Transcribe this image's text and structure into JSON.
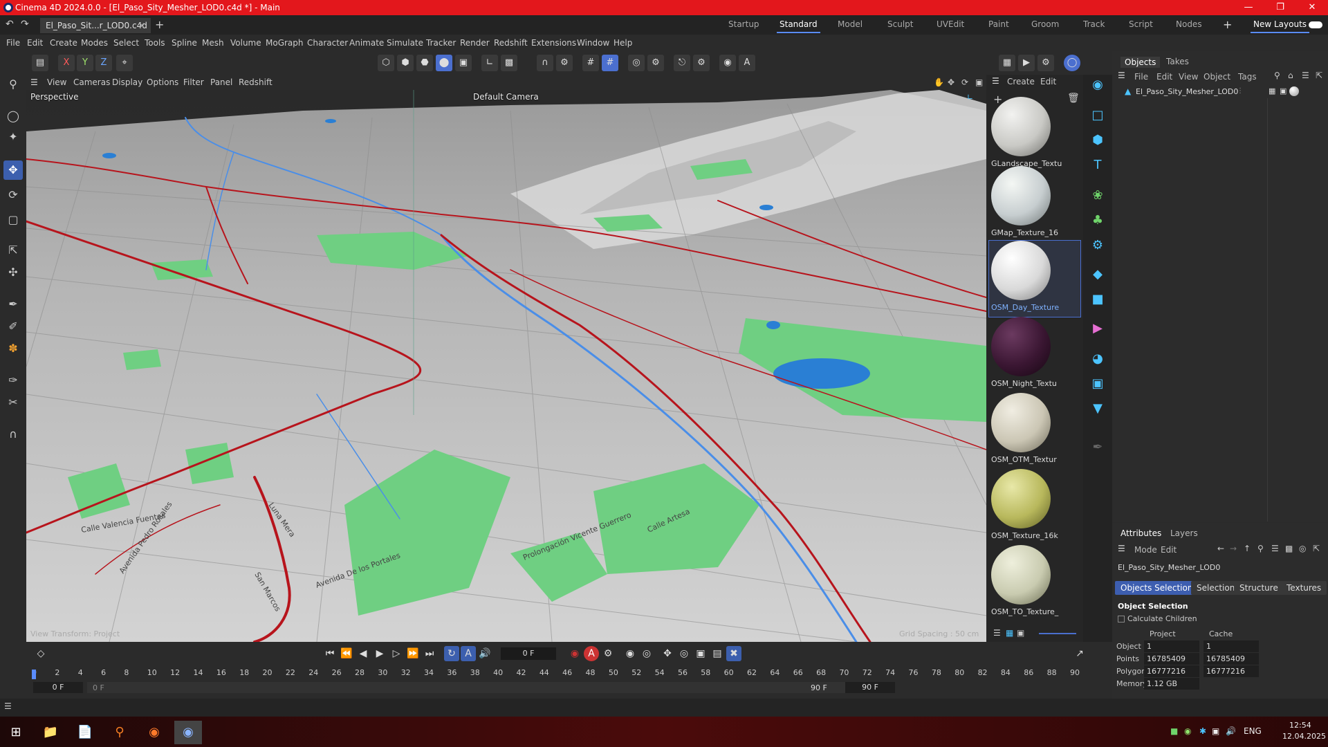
{
  "window": {
    "title": "Cinema 4D 2024.0.0 - [El_Paso_Sity_Mesher_LOD0.c4d *] - Main"
  },
  "document_tab": {
    "label": "El_Paso_Sit...r_LOD0.c4d *"
  },
  "layouts": [
    "Startup",
    "Standard",
    "Model",
    "Sculpt",
    "UVEdit",
    "Paint",
    "Groom",
    "Track",
    "Script",
    "Nodes"
  ],
  "new_layouts": "New Layouts",
  "menus": [
    "File",
    "Edit",
    "Create",
    "Modes",
    "Select",
    "Tools",
    "Spline",
    "Mesh",
    "Volume",
    "MoGraph",
    "Character",
    "Animate",
    "Simulate",
    "Tracker",
    "Render",
    "Redshift",
    "Extensions",
    "Window",
    "Help"
  ],
  "axes": {
    "x": "X",
    "y": "Y",
    "z": "Z"
  },
  "viewport_menu": [
    "View",
    "Cameras",
    "Display",
    "Options",
    "Filter",
    "Panel",
    "Redshift"
  ],
  "viewport": {
    "name": "Perspective",
    "camera": "Default Camera",
    "bottom_left": "View Transform: Project",
    "bottom_right": "Grid Spacing : 50 cm",
    "street_labels": [
      "Calle Valencia Fuentes",
      "Avenida Pedro Rosales",
      "Avenida De los Portales",
      "Prolongación Vicente Guerrero",
      "Calle Artesa",
      "Luna Mera",
      "San Marcos"
    ]
  },
  "material_menu": [
    "Create",
    "Edit"
  ],
  "materials": [
    {
      "name": "GLandscape_Textu",
      "color": "#c9c9c5"
    },
    {
      "name": "GMap_Texture_16",
      "color": "#c7ced0"
    },
    {
      "name": "OSM_Day_Texture",
      "color": "#d9d9d9"
    },
    {
      "name": "OSM_Night_Textu",
      "color": "#3a1632"
    },
    {
      "name": "OSM_OTM_Textur",
      "color": "#cbc6b4"
    },
    {
      "name": "OSM_Texture_16k",
      "color": "#b8b85c"
    },
    {
      "name": "OSM_TO_Texture_",
      "color": "#c9cbb0"
    }
  ],
  "objects_panel": {
    "tabs": [
      "Objects",
      "Takes"
    ],
    "menu": [
      "File",
      "Edit",
      "View",
      "Object",
      "Tags"
    ],
    "items": [
      {
        "name": "El_Paso_Sity_Mesher_LOD0"
      }
    ]
  },
  "attributes": {
    "tabs": [
      "Attributes",
      "Layers"
    ],
    "menu": [
      "Mode",
      "Edit"
    ],
    "object_name": "El_Paso_Sity_Mesher_LOD0",
    "buttons": [
      "Objects Selection",
      "Selection",
      "Structure",
      "Textures"
    ],
    "section": "Object Selection",
    "checkbox_label": "Calculate Children",
    "col_project": "Project",
    "col_cache": "Cache",
    "rows": [
      {
        "label": "Object",
        "project": "1",
        "cache": "1"
      },
      {
        "label": "Points",
        "project": "16785409",
        "cache": "16785409"
      },
      {
        "label": "Polygons",
        "project": "16777216",
        "cache": "16777216"
      },
      {
        "label": "Memory",
        "project": "1.12 GB",
        "cache": ""
      }
    ]
  },
  "timeline": {
    "current_frame": "0 F",
    "ticks": [
      "0",
      "2",
      "4",
      "6",
      "8",
      "10",
      "12",
      "14",
      "16",
      "18",
      "20",
      "22",
      "24",
      "26",
      "28",
      "30",
      "32",
      "34",
      "36",
      "38",
      "40",
      "42",
      "44",
      "46",
      "48",
      "50",
      "52",
      "54",
      "56",
      "58",
      "60",
      "62",
      "64",
      "66",
      "68",
      "70",
      "72",
      "74",
      "76",
      "78",
      "80",
      "82",
      "84",
      "86",
      "88",
      "90"
    ],
    "start": "0 F",
    "start2": "0 F",
    "end": "90 F",
    "end2": "90 F"
  },
  "taskbar": {
    "lang": "ENG",
    "time": "12:54",
    "date": "12.04.2025"
  }
}
